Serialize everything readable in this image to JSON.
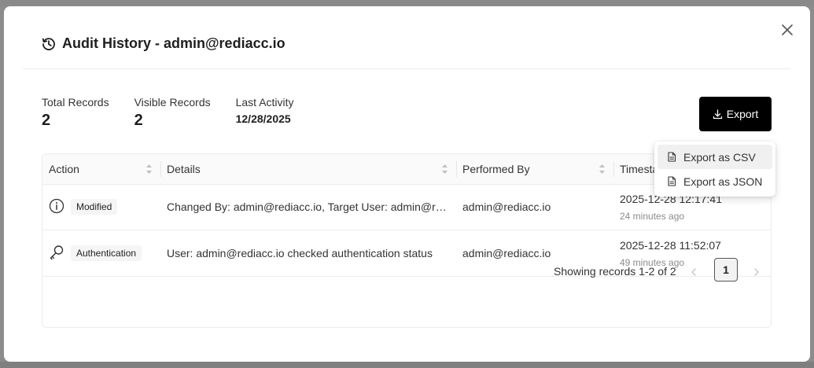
{
  "modal": {
    "title": "Audit History - admin@rediacc.io"
  },
  "stats": {
    "total_label": "Total Records",
    "total_value": "2",
    "visible_label": "Visible Records",
    "visible_value": "2",
    "last_label": "Last Activity",
    "last_value": "12/28/2025"
  },
  "export": {
    "label": "Export",
    "menu": [
      {
        "label": "Export as CSV"
      },
      {
        "label": "Export as JSON"
      }
    ]
  },
  "table": {
    "columns": [
      "Action",
      "Details",
      "Performed By",
      "Timestamp"
    ],
    "rows": [
      {
        "icon": "info-icon",
        "action": "Modified",
        "details": "Changed By: admin@rediacc.io, Target User: admin@rediacc.io",
        "performed_by": "admin@rediacc.io",
        "timestamp": "2025-12-28 12:17:41",
        "relative": "24 minutes ago"
      },
      {
        "icon": "key-icon",
        "action": "Authentication",
        "details": "User: admin@rediacc.io checked authentication status",
        "performed_by": "admin@rediacc.io",
        "timestamp": "2025-12-28 11:52:07",
        "relative": "49 minutes ago"
      }
    ]
  },
  "pagination": {
    "summary": "Showing records 1-2 of 2",
    "current_page": "1"
  }
}
